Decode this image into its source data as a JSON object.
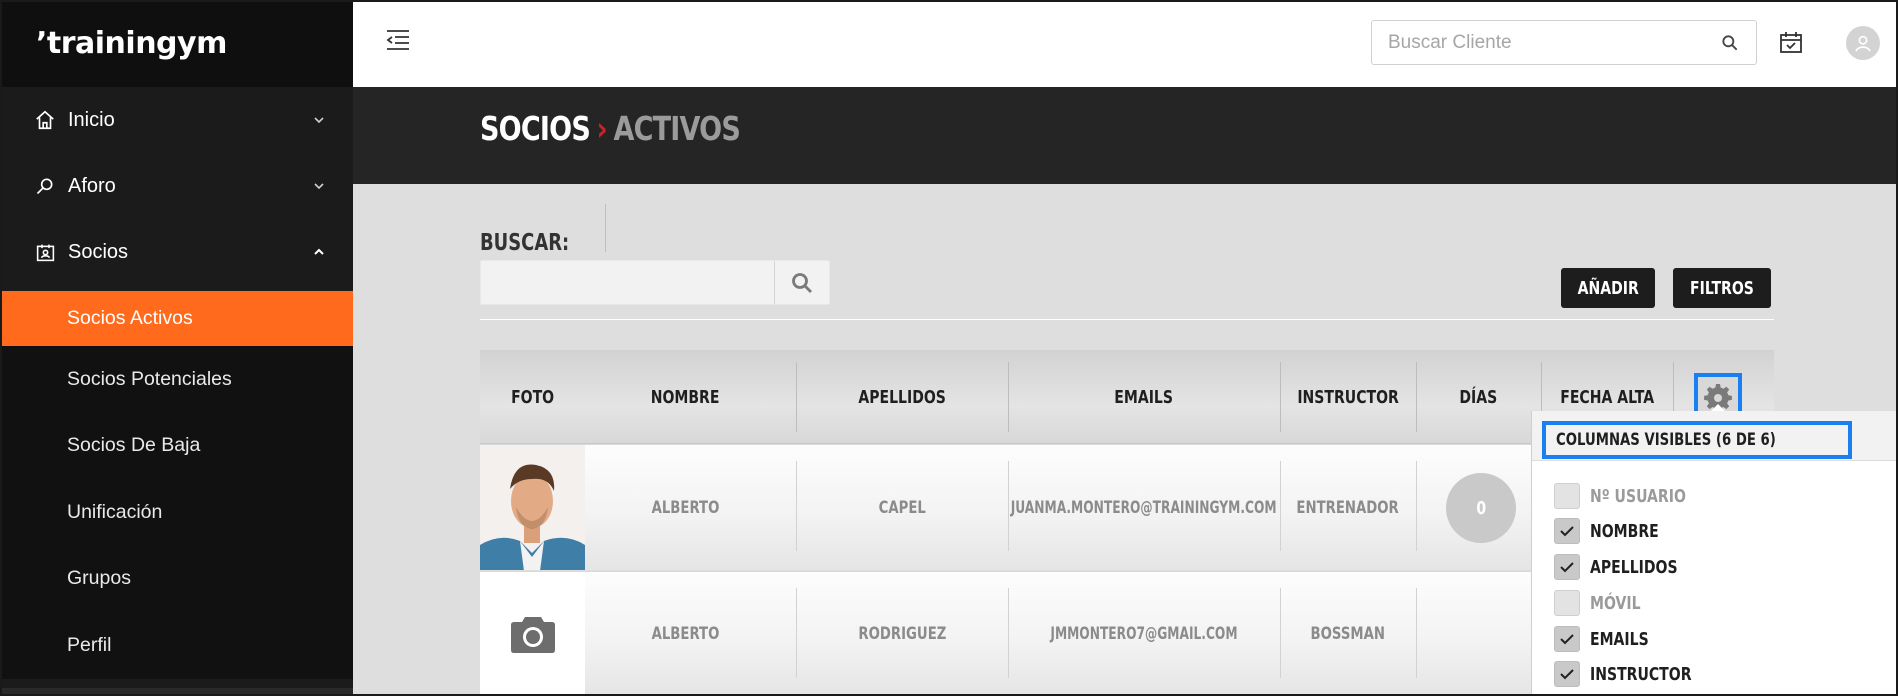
{
  "app": {
    "logo": "’trainingym"
  },
  "sidebar": {
    "items": [
      {
        "label": "Inicio",
        "icon": "home-icon"
      },
      {
        "label": "Aforo",
        "icon": "search-icon"
      },
      {
        "label": "Socios",
        "icon": "members-card-icon"
      }
    ],
    "subitems": [
      {
        "label": "Socios Activos",
        "active": true
      },
      {
        "label": "Socios Potenciales"
      },
      {
        "label": "Socios De Baja"
      },
      {
        "label": "Unificación"
      },
      {
        "label": "Grupos"
      },
      {
        "label": "Perfil"
      }
    ]
  },
  "topbar": {
    "search_placeholder": "Buscar Cliente",
    "icons": [
      "menu-collapse-icon",
      "search-icon",
      "calendar-check-icon",
      "user-avatar-icon"
    ]
  },
  "header": {
    "section": "SOCIOS",
    "separator": "›",
    "subsection": "ACTIVOS"
  },
  "toolbar": {
    "search_label": "BUSCAR:",
    "search_value": "",
    "add_label": "AÑADIR",
    "filters_label": "FILTROS"
  },
  "table": {
    "columns": [
      "FOTO",
      "NOMBRE",
      "APELLIDOS",
      "EMAILS",
      "INSTRUCTOR",
      "DÍAS",
      "FECHA ALTA"
    ],
    "rows": [
      {
        "nombre": "ALBERTO",
        "apellidos": "CAPEL",
        "email": "JUANMA.MONTERO@TRAININGYM.COM",
        "instructor": "ENTRENADOR",
        "dias": "0",
        "photo": "profile-photo"
      },
      {
        "nombre": "ALBERTO",
        "apellidos": "RODRIGUEZ",
        "email": "JMMONTERO7@GMAIL.COM",
        "instructor": "BOSSMAN",
        "dias": "",
        "photo": "camera-icon"
      }
    ]
  },
  "column_picker": {
    "title": "COLUMNAS VISIBLES (6 DE 6)",
    "options": [
      {
        "label": "Nº USUARIO",
        "checked": false,
        "disabled": true
      },
      {
        "label": "NOMBRE",
        "checked": true,
        "disabled": false
      },
      {
        "label": "APELLIDOS",
        "checked": true,
        "disabled": false
      },
      {
        "label": "MÓVIL",
        "checked": false,
        "disabled": true
      },
      {
        "label": "EMAILS",
        "checked": true,
        "disabled": false
      },
      {
        "label": "INSTRUCTOR",
        "checked": true,
        "disabled": false
      }
    ]
  },
  "colors": {
    "accent": "#ff6a1c",
    "sidebar": "#1b1b1b",
    "highlight": "#1a7ff0",
    "crumb_separator": "#d0202a"
  }
}
